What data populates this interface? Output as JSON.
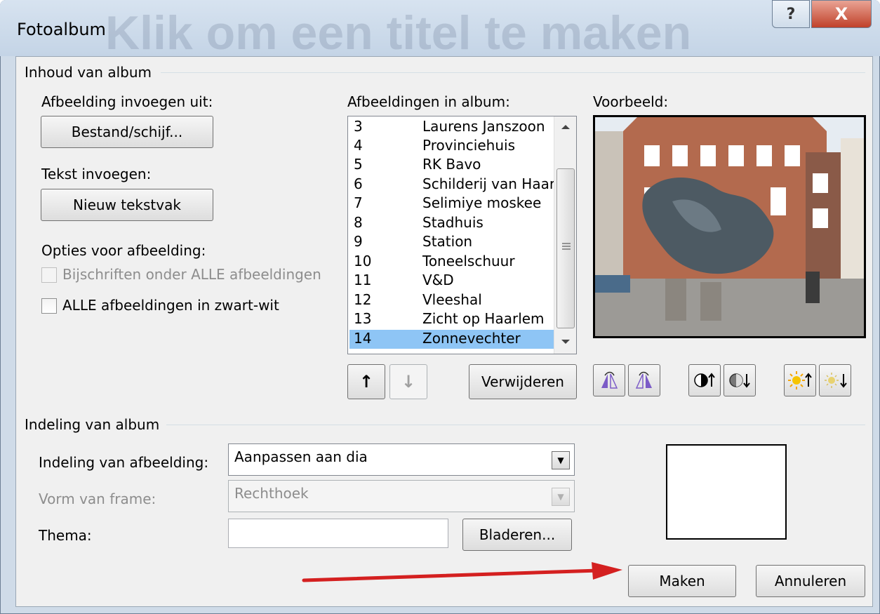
{
  "window": {
    "title": "Fotoalbum",
    "background_hint": "Klik om een titel te maken",
    "help_glyph": "?",
    "close_glyph": "X"
  },
  "content_group": {
    "label": "Inhoud van album"
  },
  "insert_picture": {
    "label": "Afbeelding invoegen uit:",
    "button": "Bestand/schijf..."
  },
  "insert_text": {
    "label": "Tekst invoegen:",
    "button": "Nieuw tekstvak"
  },
  "picture_options": {
    "label": "Opties voor afbeelding:",
    "captions": {
      "label": "Bijschriften onder ALLE afbeeldingen",
      "checked": false,
      "enabled": false
    },
    "black_white": {
      "label": "ALLE afbeeldingen in zwart-wit",
      "checked": false,
      "enabled": true
    }
  },
  "album_pictures": {
    "label": "Afbeeldingen in album:",
    "items": [
      {
        "num": "3",
        "name": "Laurens Janszoon"
      },
      {
        "num": "4",
        "name": "Provinciehuis"
      },
      {
        "num": "5",
        "name": "RK Bavo"
      },
      {
        "num": "6",
        "name": "Schilderij van Haar"
      },
      {
        "num": "7",
        "name": "Selimiye moskee"
      },
      {
        "num": "8",
        "name": "Stadhuis"
      },
      {
        "num": "9",
        "name": "Station"
      },
      {
        "num": "10",
        "name": "Toneelschuur"
      },
      {
        "num": "11",
        "name": "V&D"
      },
      {
        "num": "12",
        "name": "Vleeshal"
      },
      {
        "num": "13",
        "name": "Zicht op Haarlem"
      },
      {
        "num": "14",
        "name": "Zonnevechter"
      }
    ],
    "selected": "14",
    "move_up_glyph": "↑",
    "move_down_glyph": "↓",
    "remove_button": "Verwijderen"
  },
  "preview": {
    "label": "Voorbeeld:",
    "tools": [
      "rotate-left-icon",
      "rotate-right-icon",
      "contrast-up-icon",
      "contrast-down-icon",
      "brightness-up-icon",
      "brightness-down-icon"
    ]
  },
  "layout_group": {
    "label": "Indeling van album"
  },
  "picture_layout": {
    "label": "Indeling van afbeelding:",
    "value": "Aanpassen aan dia",
    "enabled": true
  },
  "frame_shape": {
    "label": "Vorm van frame:",
    "value": "Rechthoek",
    "enabled": false
  },
  "theme": {
    "label": "Thema:",
    "value": "",
    "browse_button": "Bladeren..."
  },
  "footer": {
    "create_button": "Maken",
    "cancel_button": "Annuleren"
  },
  "colors": {
    "selection": "#8ec5f5",
    "annotation_arrow": "#d42020",
    "close_button": "#c0412a"
  }
}
